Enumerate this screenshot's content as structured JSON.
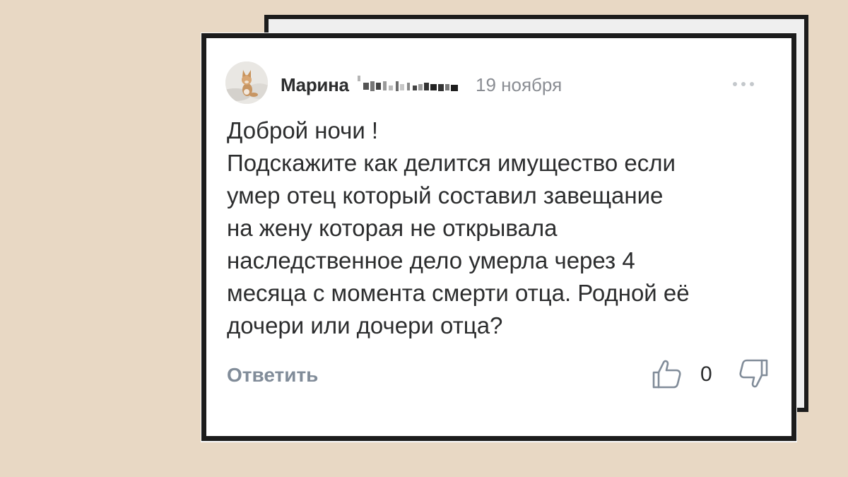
{
  "comment": {
    "author_name": "Марина",
    "date": "19 ноября",
    "lines": [
      "Доброй ночи !",
      "Подскажите как делится имущество если",
      "умер отец который составил завещание",
      "на жену которая не открывала",
      "наследственное дело умерла через 4",
      "месяца с момента смерти отца. Родной её",
      "дочери или дочери отца?"
    ]
  },
  "actions": {
    "reply_label": "Ответить",
    "likes_count": "0"
  },
  "icons": {
    "more": "more-horizontal-icon",
    "like": "thumb-up-icon",
    "dislike": "thumb-down-icon"
  },
  "colors": {
    "background": "#e8d8c4",
    "card": "#ffffff",
    "border": "#1c1c1c",
    "text": "#2c2d2e",
    "muted": "#818c99",
    "date": "#8a8d93"
  }
}
